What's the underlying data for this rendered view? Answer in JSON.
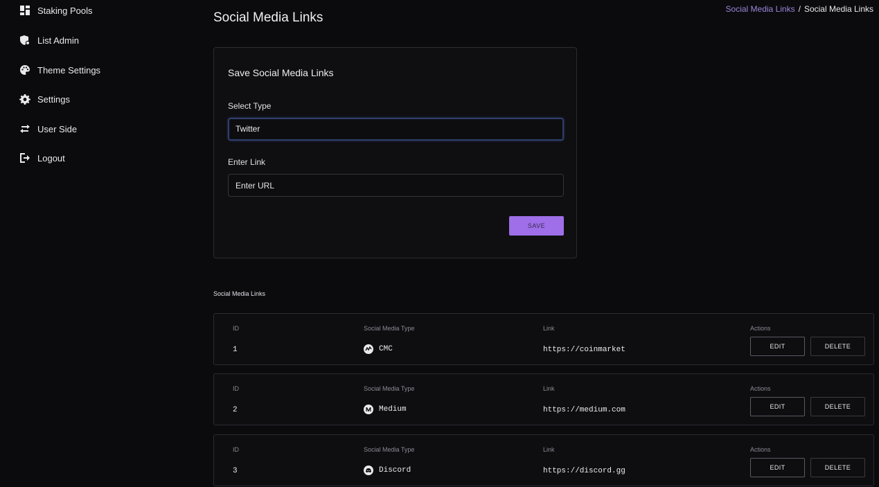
{
  "sidebar": {
    "items": [
      {
        "label": "Staking Pools",
        "icon": "dashboard-icon"
      },
      {
        "label": "List Admin",
        "icon": "admin-shield-icon"
      },
      {
        "label": "Theme Settings",
        "icon": "palette-icon"
      },
      {
        "label": "Settings",
        "icon": "gear-icon"
      },
      {
        "label": "User Side",
        "icon": "swap-arrows-icon"
      },
      {
        "label": "Logout",
        "icon": "logout-icon"
      }
    ]
  },
  "header": {
    "title": "Social Media Links",
    "breadcrumb": {
      "link": "Social Media Links",
      "separator": "/",
      "current": "Social Media Links"
    }
  },
  "form": {
    "title": "Save Social Media Links",
    "type_label": "Select Type",
    "type_value": "Twitter",
    "link_label": "Enter Link",
    "link_placeholder": "Enter URL",
    "save_label": "SAVE"
  },
  "table": {
    "title": "Social Media Links",
    "headers": {
      "id": "ID",
      "type": "Social Media Type",
      "link": "Link",
      "actions": "Actions"
    },
    "edit_label": "EDIT",
    "delete_label": "DELETE",
    "rows": [
      {
        "id": "1",
        "type": "CMC",
        "icon": "coinmarketcap-icon",
        "link": "https://coinmarket"
      },
      {
        "id": "2",
        "type": "Medium",
        "icon": "medium-icon",
        "link": "https://medium.com"
      },
      {
        "id": "3",
        "type": "Discord",
        "icon": "discord-icon",
        "link": "https://discord.gg"
      }
    ]
  },
  "colors": {
    "background": "#0b0b0e",
    "accent": "#9e6fe8",
    "breadcrumb_link": "#9b86d8",
    "card_border": "#2b2b31"
  }
}
